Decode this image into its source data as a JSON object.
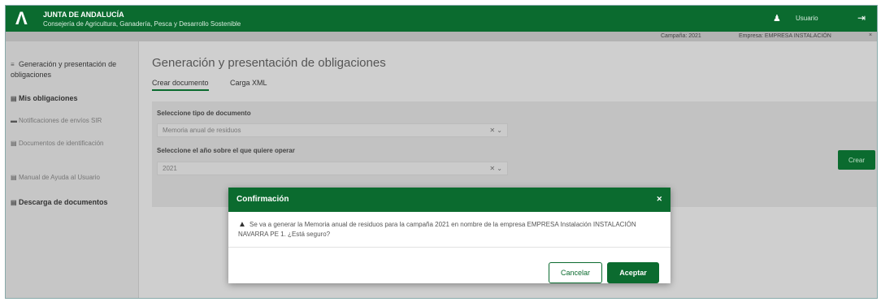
{
  "header": {
    "org_line1": "JUNTA DE ANDALUCÍA",
    "org_line2": "Consejería de Agricultura, Ganadería, Pesca y Desarrollo Sostenible",
    "user_name": "Usuario",
    "icons": {
      "logo": "logo-icon",
      "user": "user-icon",
      "logout": "logout-icon"
    }
  },
  "infobar": {
    "item1": "Campaña: 2021",
    "item2": "Empresa: EMPRESA INSTALACIÓN",
    "close": "×"
  },
  "sidebar": {
    "items": [
      {
        "icon": "≡",
        "label": "Generación y presentación de obligaciones",
        "bold": false
      },
      {
        "icon": "▤",
        "label": "Mis obligaciones",
        "bold": true
      },
      {
        "icon": "▬",
        "label": "Notificaciones de envíos SIR",
        "bold": false
      },
      {
        "icon": "▤",
        "label": "Documentos de identificación",
        "bold": false
      },
      {
        "icon": "▤",
        "label": "Manual de Ayuda al Usuario",
        "bold": false
      },
      {
        "icon": "▤",
        "label": "Descarga de documentos",
        "bold": true
      }
    ]
  },
  "main": {
    "title": "Generación y presentación de obligaciones",
    "tabs": [
      {
        "label": "Crear documento"
      },
      {
        "label": "Carga XML"
      }
    ],
    "form": {
      "doc_type_label": "Seleccione tipo de documento",
      "doc_type_value": "Memoria anual de residuos",
      "year_label": "Seleccione el año sobre el que quiere operar",
      "year_value": "2021",
      "select_arrows": "✕ ⌄"
    },
    "generate_button": "Crear"
  },
  "modal": {
    "title": "Confirmación",
    "close": "✕",
    "warning_icon": "▲",
    "message": "Se va a generar la Memoria anual de residuos para la campaña 2021 en nombre de la empresa EMPRESA Instalación INSTALACIÓN NAVARRA PE 1. ¿Está seguro?",
    "cancel_label": "Cancelar",
    "accept_label": "Aceptar"
  },
  "colors": {
    "brand_green": "#0b6b2f",
    "overlay_gray": "#cfcfcf"
  }
}
